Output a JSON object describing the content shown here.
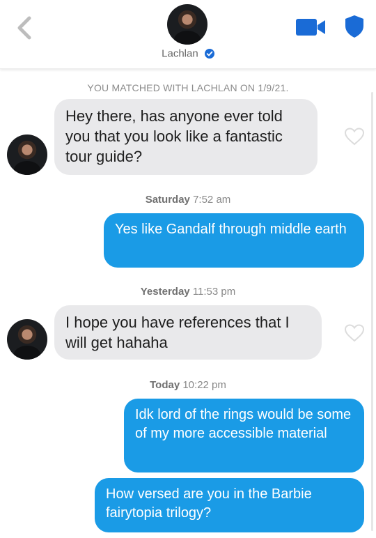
{
  "header": {
    "name": "Lachlan",
    "icons": [
      "chevron-left-icon",
      "video-camera-icon",
      "shield-icon",
      "verified-check-icon"
    ],
    "accent_color": "#1a6bd6"
  },
  "match_banner": "YOU MATCHED WITH LACHLAN ON 1/9/21.",
  "messages": [
    {
      "sender": "Lachlan",
      "text": "Hey there, has anyone ever told you that you look like a fantastic tour guide?"
    },
    {
      "timestamp_day": "Saturday",
      "timestamp_time": "7:52 am"
    },
    {
      "sender": "me",
      "text": "Yes like Gandalf through middle earth"
    },
    {
      "timestamp_day": "Yesterday",
      "timestamp_time": "11:53 pm"
    },
    {
      "sender": "Lachlan",
      "text": "I hope you have references that I will get hahaha"
    },
    {
      "timestamp_day": "Today",
      "timestamp_time": "10:22 pm"
    },
    {
      "sender": "me",
      "text": "Idk lord of the rings would be some of my more accessible material"
    },
    {
      "sender": "me",
      "text": "How versed are you in the Barbie fairytopia trilogy?"
    }
  ],
  "colors": {
    "outgoing_bubble": "#1a9be6",
    "incoming_bubble": "#e9e9eb",
    "timestamp": "#888888"
  }
}
